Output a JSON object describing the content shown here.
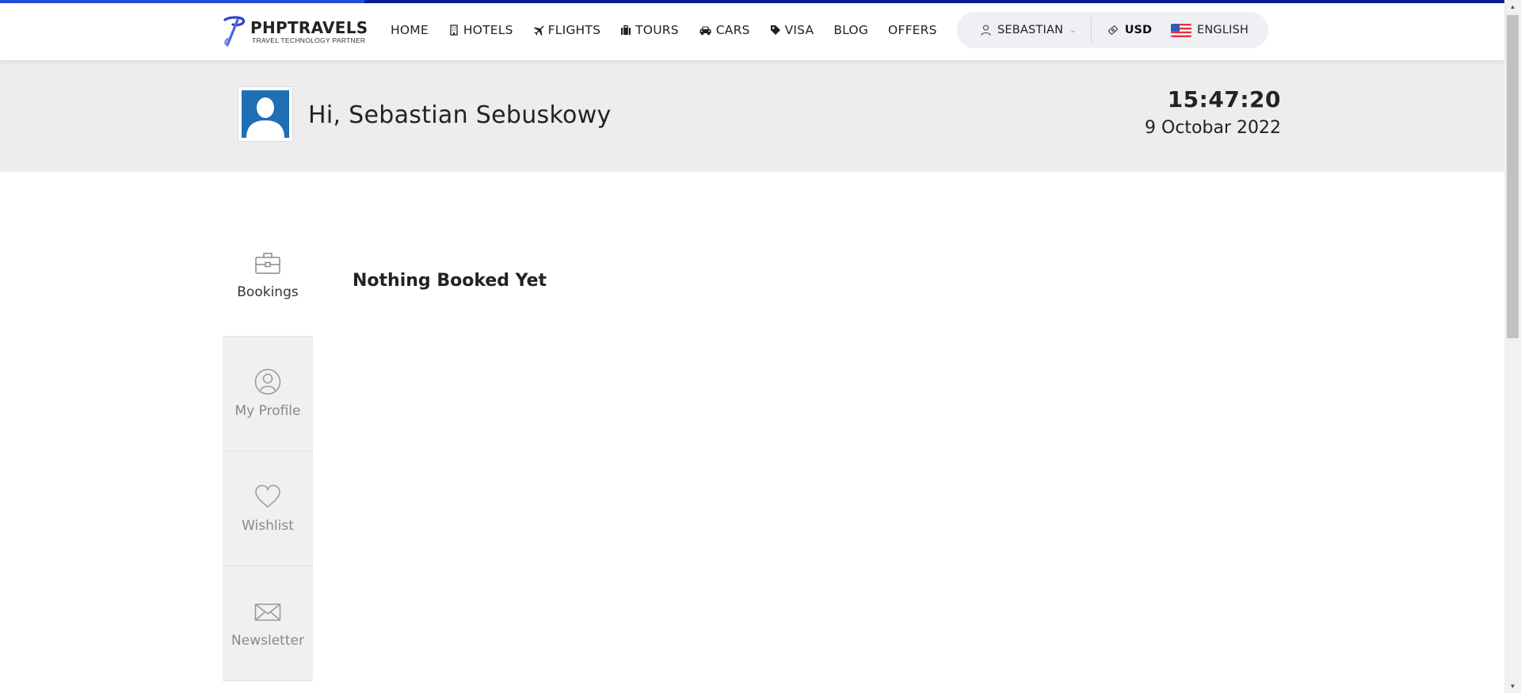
{
  "brand": {
    "name": "PHPTRAVELS",
    "tagline": "TRAVEL TECHNOLOGY PARTNER",
    "accent_color": "#1e4fd8"
  },
  "nav": {
    "items": [
      {
        "label": "HOME",
        "icon": ""
      },
      {
        "label": "HOTELS",
        "icon": "building-icon"
      },
      {
        "label": "FLIGHTS",
        "icon": "plane-icon"
      },
      {
        "label": "TOURS",
        "icon": "suitcase-icon"
      },
      {
        "label": "CARS",
        "icon": "car-icon"
      },
      {
        "label": "VISA",
        "icon": "tag-icon"
      },
      {
        "label": "BLOG",
        "icon": ""
      },
      {
        "label": "OFFERS",
        "icon": ""
      }
    ]
  },
  "account": {
    "username": "SEBASTIAN",
    "currency": "USD",
    "language": "ENGLISH"
  },
  "hero": {
    "greeting": "Hi, Sebastian Sebuskowy",
    "time": "15:47:20",
    "date": "9 Octobar 2022"
  },
  "sidebar": {
    "items": [
      {
        "label": "Bookings",
        "icon": "briefcase-icon",
        "active": true
      },
      {
        "label": "My Profile",
        "icon": "user-circle-icon",
        "active": false
      },
      {
        "label": "Wishlist",
        "icon": "heart-icon",
        "active": false
      },
      {
        "label": "Newsletter",
        "icon": "envelope-icon",
        "active": false
      }
    ]
  },
  "main": {
    "empty_message": "Nothing Booked Yet"
  }
}
